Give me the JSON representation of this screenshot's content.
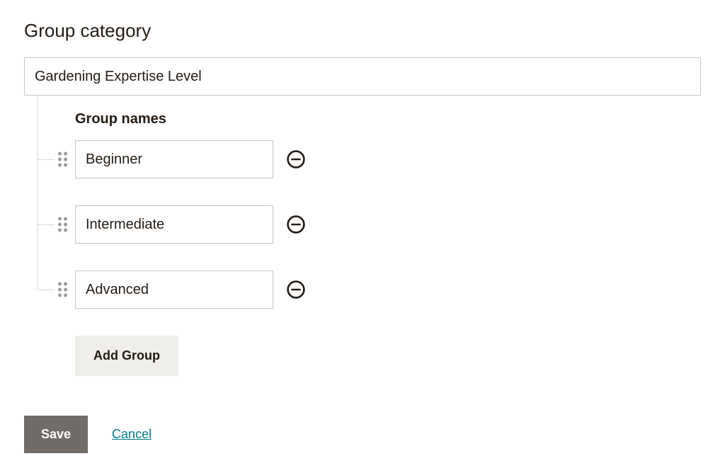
{
  "section_title": "Group category",
  "category_value": "Gardening Expertise Level",
  "group_names_label": "Group names",
  "groups": [
    {
      "value": "Beginner"
    },
    {
      "value": "Intermediate"
    },
    {
      "value": "Advanced"
    }
  ],
  "add_group_label": "Add Group",
  "save_label": "Save",
  "cancel_label": "Cancel"
}
